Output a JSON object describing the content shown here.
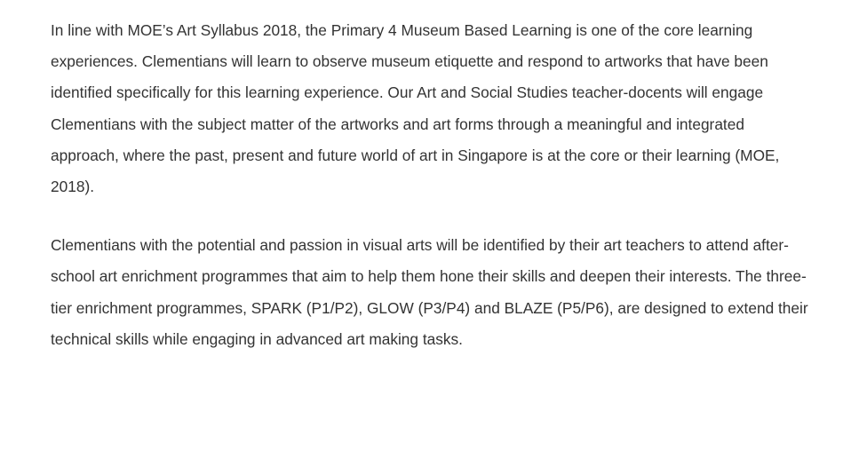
{
  "article": {
    "paragraphs": [
      "In line with MOE’s Art Syllabus 2018, the Primary 4 Museum Based Learning is one of the core learning experiences. Clementians will learn to observe museum etiquette and respond to artworks that have been identified specifically for this learning experience. Our Art and Social Studies teacher-docents will engage Clementians with the subject matter of the artworks and art forms through a meaningful and integrated approach, where the past, present and future world of art in Singapore is at the core or their learning (MOE, 2018).",
      "Clementians with the potential and passion in visual arts will be identified by their art teachers to attend after-school art enrichment programmes that aim to help them hone their skills and deepen their interests. The three-tier enrichment programmes, SPARK (P1/P2), GLOW (P3/P4) and BLAZE (P5/P6), are designed to extend their technical skills while engaging in advanced art making tasks."
    ]
  }
}
